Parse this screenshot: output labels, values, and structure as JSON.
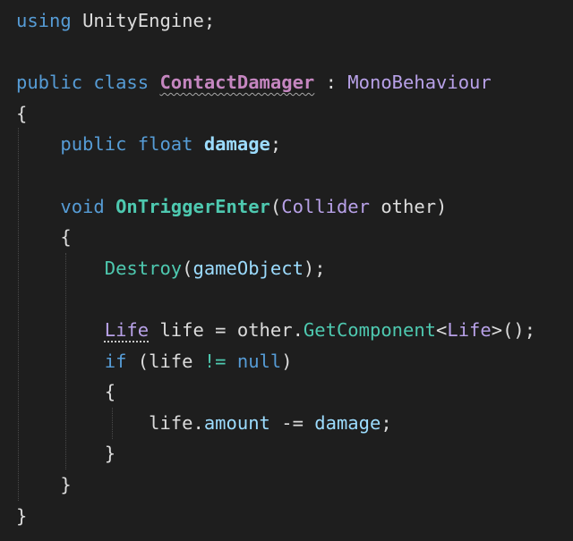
{
  "code": {
    "lines": [
      [
        {
          "t": "using",
          "c": "#569cd6"
        },
        {
          "t": " "
        },
        {
          "t": "UnityEngine",
          "c": "#dcdcdc"
        },
        {
          "t": ";"
        }
      ],
      [],
      [
        {
          "t": "public",
          "c": "#569cd6"
        },
        {
          "t": " "
        },
        {
          "t": "class",
          "c": "#569cd6"
        },
        {
          "t": " "
        },
        {
          "t": "ContactDamager",
          "c": "#c586c0",
          "bold": true,
          "squiggle": true
        },
        {
          "t": " : "
        },
        {
          "t": "MonoBehaviour",
          "c": "#b8a1e8"
        }
      ],
      [
        {
          "t": "{"
        }
      ],
      [
        {
          "t": "    "
        },
        {
          "t": "public",
          "c": "#569cd6"
        },
        {
          "t": " "
        },
        {
          "t": "float",
          "c": "#569cd6"
        },
        {
          "t": " "
        },
        {
          "t": "damage",
          "c": "#9cdcfe",
          "bold": true
        },
        {
          "t": ";"
        }
      ],
      [],
      [
        {
          "t": "    "
        },
        {
          "t": "void",
          "c": "#569cd6"
        },
        {
          "t": " "
        },
        {
          "t": "OnTriggerEnter",
          "c": "#4ec9b0",
          "bold": true
        },
        {
          "t": "("
        },
        {
          "t": "Collider",
          "c": "#b8a1e8"
        },
        {
          "t": " other)"
        }
      ],
      [
        {
          "t": "    {"
        }
      ],
      [
        {
          "t": "        "
        },
        {
          "t": "Destroy",
          "c": "#4ec9b0"
        },
        {
          "t": "("
        },
        {
          "t": "gameObject",
          "c": "#9cdcfe"
        },
        {
          "t": ");"
        }
      ],
      [],
      [
        {
          "t": "        "
        },
        {
          "t": "Life",
          "c": "#b8a1e8",
          "dotted": true
        },
        {
          "t": " life = other."
        },
        {
          "t": "GetComponent",
          "c": "#4ec9b0"
        },
        {
          "t": "<"
        },
        {
          "t": "Life",
          "c": "#b8a1e8"
        },
        {
          "t": ">();"
        }
      ],
      [
        {
          "t": "        "
        },
        {
          "t": "if",
          "c": "#569cd6"
        },
        {
          "t": " (life "
        },
        {
          "t": "!=",
          "c": "#4ec9b0"
        },
        {
          "t": " "
        },
        {
          "t": "null",
          "c": "#569cd6"
        },
        {
          "t": ")"
        }
      ],
      [
        {
          "t": "        {"
        }
      ],
      [
        {
          "t": "            life."
        },
        {
          "t": "amount",
          "c": "#9cdcfe"
        },
        {
          "t": " -= "
        },
        {
          "t": "damage",
          "c": "#9cdcfe"
        },
        {
          "t": ";"
        }
      ],
      [
        {
          "t": "        }"
        }
      ],
      [
        {
          "t": "    }"
        }
      ],
      [
        {
          "t": "}"
        }
      ]
    ]
  }
}
